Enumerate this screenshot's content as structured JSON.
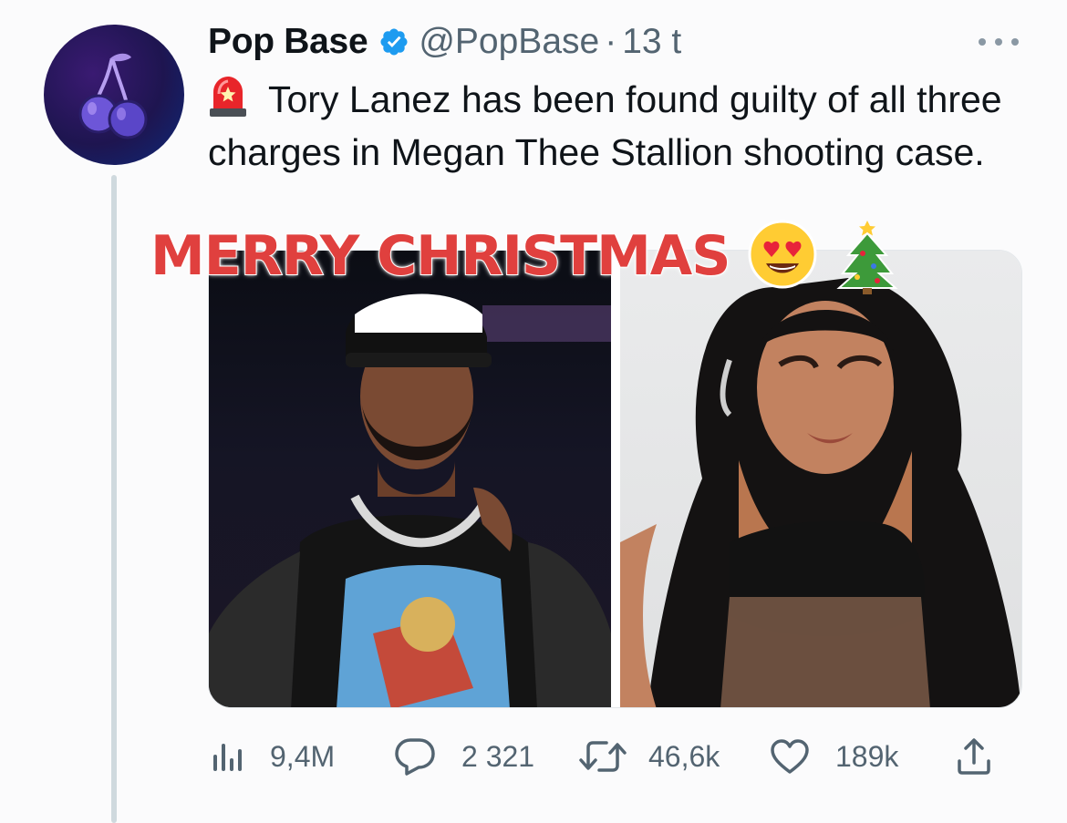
{
  "author": {
    "name": "Pop Base",
    "handle": "@PopBase",
    "separator": "·",
    "time": "13 t",
    "avatar_icon": "cherry-icon",
    "verified_color": "#1d9bf0"
  },
  "tweet": {
    "emoji": "siren-icon",
    "text": "Tory Lanez has been found guilty of all three charges in Megan Thee Stallion shooting case."
  },
  "overlay": {
    "text": "MERRY CHRISTMAS",
    "color": "#e0403e",
    "emojis": [
      "heart-eyes-icon",
      "christmas-tree-icon"
    ]
  },
  "media": {
    "images": [
      {
        "subject": "photo-left"
      },
      {
        "subject": "photo-right"
      }
    ]
  },
  "actions": {
    "views": "9,4M",
    "replies": "2 321",
    "retweets": "46,6k",
    "likes": "189k"
  }
}
